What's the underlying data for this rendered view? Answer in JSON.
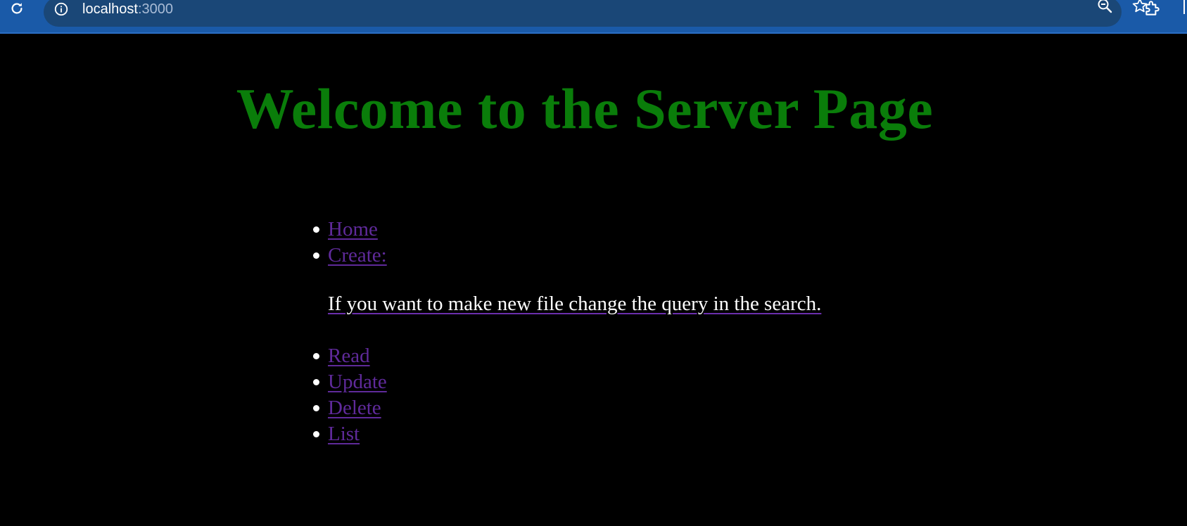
{
  "browser": {
    "url_host": "localhost",
    "url_port": ":3000",
    "icons": {
      "reload": "reload-icon",
      "site_info": "info-icon",
      "zoom": "zoom-out-icon",
      "bookmark": "star-icon",
      "extensions": "puzzle-icon"
    }
  },
  "page": {
    "title": "Welcome to the Server Page",
    "nav": {
      "home": "Home",
      "create": "Create:",
      "create_note": "If you want to make new file change the query in the search.",
      "read": "Read",
      "update": "Update",
      "delete": "Delete",
      "list": "List"
    }
  },
  "colors": {
    "background": "#000000",
    "title": "#0a7d0a",
    "link": "#5f2a9a",
    "text": "#ffffff",
    "toolbar": "#1a5aa8"
  }
}
